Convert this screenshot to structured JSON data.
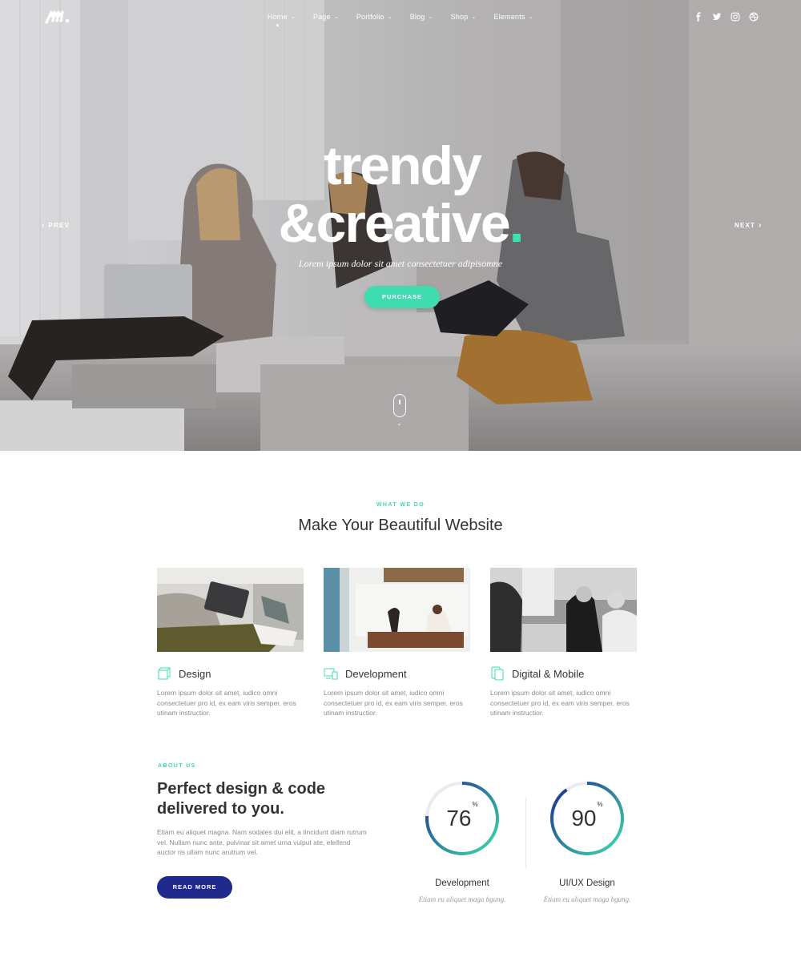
{
  "nav": {
    "items": [
      {
        "label": "Home",
        "active": true
      },
      {
        "label": "Page"
      },
      {
        "label": "Portfolio"
      },
      {
        "label": "Blog"
      },
      {
        "label": "Shop"
      },
      {
        "label": "Elements"
      }
    ],
    "social": [
      "facebook-icon",
      "twitter-icon",
      "instagram-icon",
      "dribbble-icon"
    ]
  },
  "hero": {
    "line1": "trendy",
    "line2": "&creative",
    "dot": ".",
    "tagline": "Lorem ipsum dolor sit amet consectetuer adipisomne",
    "button": "PURCHASE",
    "prev": "PREV",
    "next": "NEXT"
  },
  "whatwedo": {
    "eyebrow": "WHAT WE DO",
    "title": "Make Your Beautiful Website",
    "services": [
      {
        "title": "Design",
        "desc": "Lorem ipsum dolor sit amet, iudico omni consectetuer pro id, ex eam viris semper, eros utinam instructior.",
        "icon": "cube-icon"
      },
      {
        "title": "Development",
        "desc": "Lorem ipsum dolor sit amet, iudico omni consectetuer pro id, ex eam viris semper, eros utinam instructior.",
        "icon": "devices-icon"
      },
      {
        "title": "Digital & Mobile",
        "desc": "Lorem ipsum dolor sit amet, iudico omni consectetuer pro id, ex eam viris semper, eros utinam instructior.",
        "icon": "mobile-icon"
      }
    ]
  },
  "about": {
    "eyebrow": "ABOUT US",
    "title_line1": "Perfect design & code",
    "title_line2": "delivered to you.",
    "text": "Etiam eu aliquet magna. Nam sodales dui elit, a tincidunt diam rutrum vel. Nullam nunc ante, pulvinar sit amet urna vulput ate, eleifend auctor ris ullam nunc arutrum vel.",
    "button": "READ MORE"
  },
  "skills": [
    {
      "value": "76",
      "percent": 76,
      "unit": "%",
      "label": "Development",
      "sub": "Etiam eu aliquet maga bgung."
    },
    {
      "value": "90",
      "percent": 90,
      "unit": "%",
      "label": "UI/UX Design",
      "sub": "Etiam eu aliquet maga bgung."
    }
  ],
  "colors": {
    "accent": "#3fdcaf",
    "primary": "#1f2a8c",
    "track": "#ebebeb"
  }
}
